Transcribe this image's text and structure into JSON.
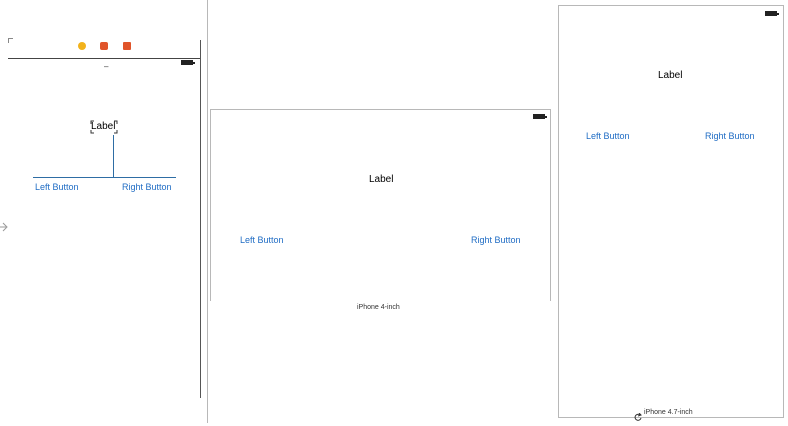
{
  "editor": {
    "scene": {
      "dock_icons": [
        "view-controller-icon",
        "first-responder-icon",
        "exit-icon"
      ],
      "title_dash": "–",
      "label_text": "Label",
      "left_button": "Left Button",
      "right_button": "Right Button"
    }
  },
  "preview_4inch": {
    "label_text": "Label",
    "left_button": "Left Button",
    "right_button": "Right Button",
    "device_caption": "iPhone 4-inch"
  },
  "preview_47inch": {
    "label_text": "Label",
    "left_button": "Left Button",
    "right_button": "Right Button",
    "device_caption": "iPhone 4.7-inch"
  },
  "colors": {
    "button_text": "#1f6cc4",
    "constraint": "#2e6da4",
    "frame_border": "#b8b8b8"
  }
}
